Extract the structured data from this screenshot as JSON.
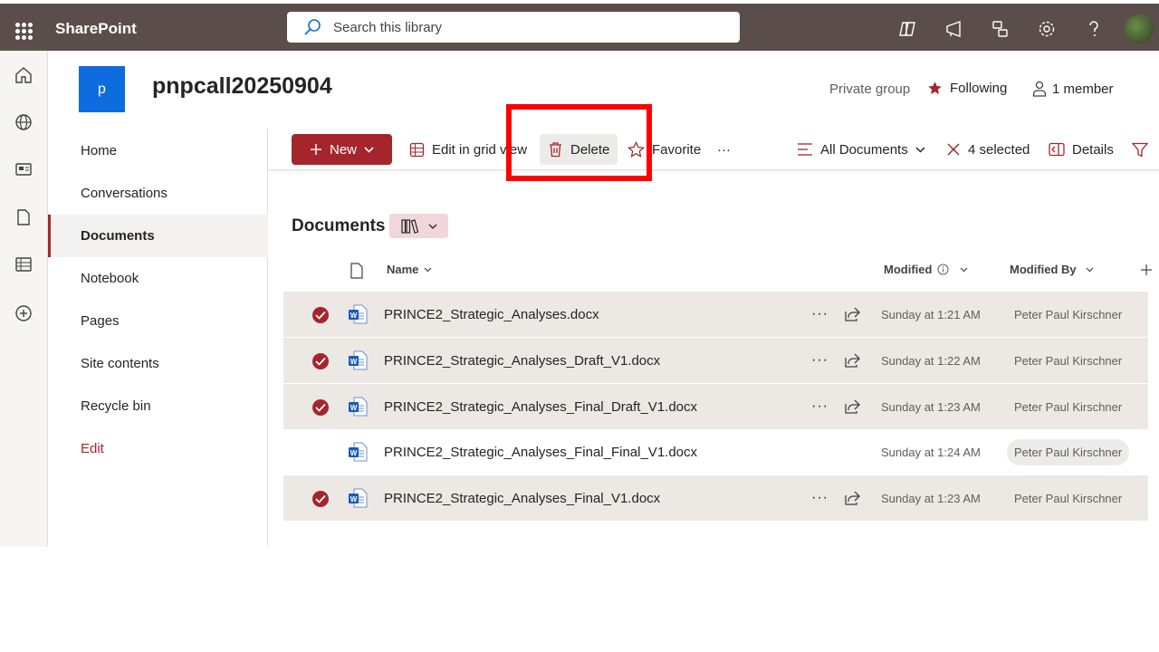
{
  "suitebar": {
    "app_name": "SharePoint",
    "search_placeholder": "Search this library"
  },
  "site": {
    "logo_letter": "p",
    "title": "pnpcall20250904",
    "privacy": "Private group",
    "following_label": "Following",
    "members_label": "1 member"
  },
  "sitenav": {
    "items": [
      {
        "label": "Home"
      },
      {
        "label": "Conversations"
      },
      {
        "label": "Documents"
      },
      {
        "label": "Notebook"
      },
      {
        "label": "Pages"
      },
      {
        "label": "Site contents"
      },
      {
        "label": "Recycle bin"
      },
      {
        "label": "Edit"
      }
    ]
  },
  "commandbar": {
    "new_label": "New",
    "edit_grid_label": "Edit in grid view",
    "delete_label": "Delete",
    "favorite_label": "Favorite",
    "more_label": "···",
    "view_label": "All Documents",
    "selected_label": "4 selected",
    "details_label": "Details"
  },
  "library": {
    "title": "Documents",
    "columns": {
      "name": "Name",
      "modified": "Modified",
      "modified_by": "Modified By"
    },
    "rows": [
      {
        "name": "PRINCE2_Strategic_Analyses.docx",
        "modified": "Sunday at 1:21 AM",
        "modified_by": "Peter Paul Kirschner",
        "selected": true
      },
      {
        "name": "PRINCE2_Strategic_Analyses_Draft_V1.docx",
        "modified": "Sunday at 1:22 AM",
        "modified_by": "Peter Paul Kirschner",
        "selected": true
      },
      {
        "name": "PRINCE2_Strategic_Analyses_Final_Draft_V1.docx",
        "modified": "Sunday at 1:23 AM",
        "modified_by": "Peter Paul Kirschner",
        "selected": true
      },
      {
        "name": "PRINCE2_Strategic_Analyses_Final_Final_V1.docx",
        "modified": "Sunday at 1:24 AM",
        "modified_by": "Peter Paul Kirschner",
        "selected": false
      },
      {
        "name": "PRINCE2_Strategic_Analyses_Final_V1.docx",
        "modified": "Sunday at 1:23 AM",
        "modified_by": "Peter Paul Kirschner",
        "selected": true
      }
    ],
    "row_more_label": "···"
  },
  "colors": {
    "suitebar": "#5b4e4a",
    "accent": "#a4262c",
    "site_logo": "#0f6cde",
    "highlight": "#ff0000"
  }
}
